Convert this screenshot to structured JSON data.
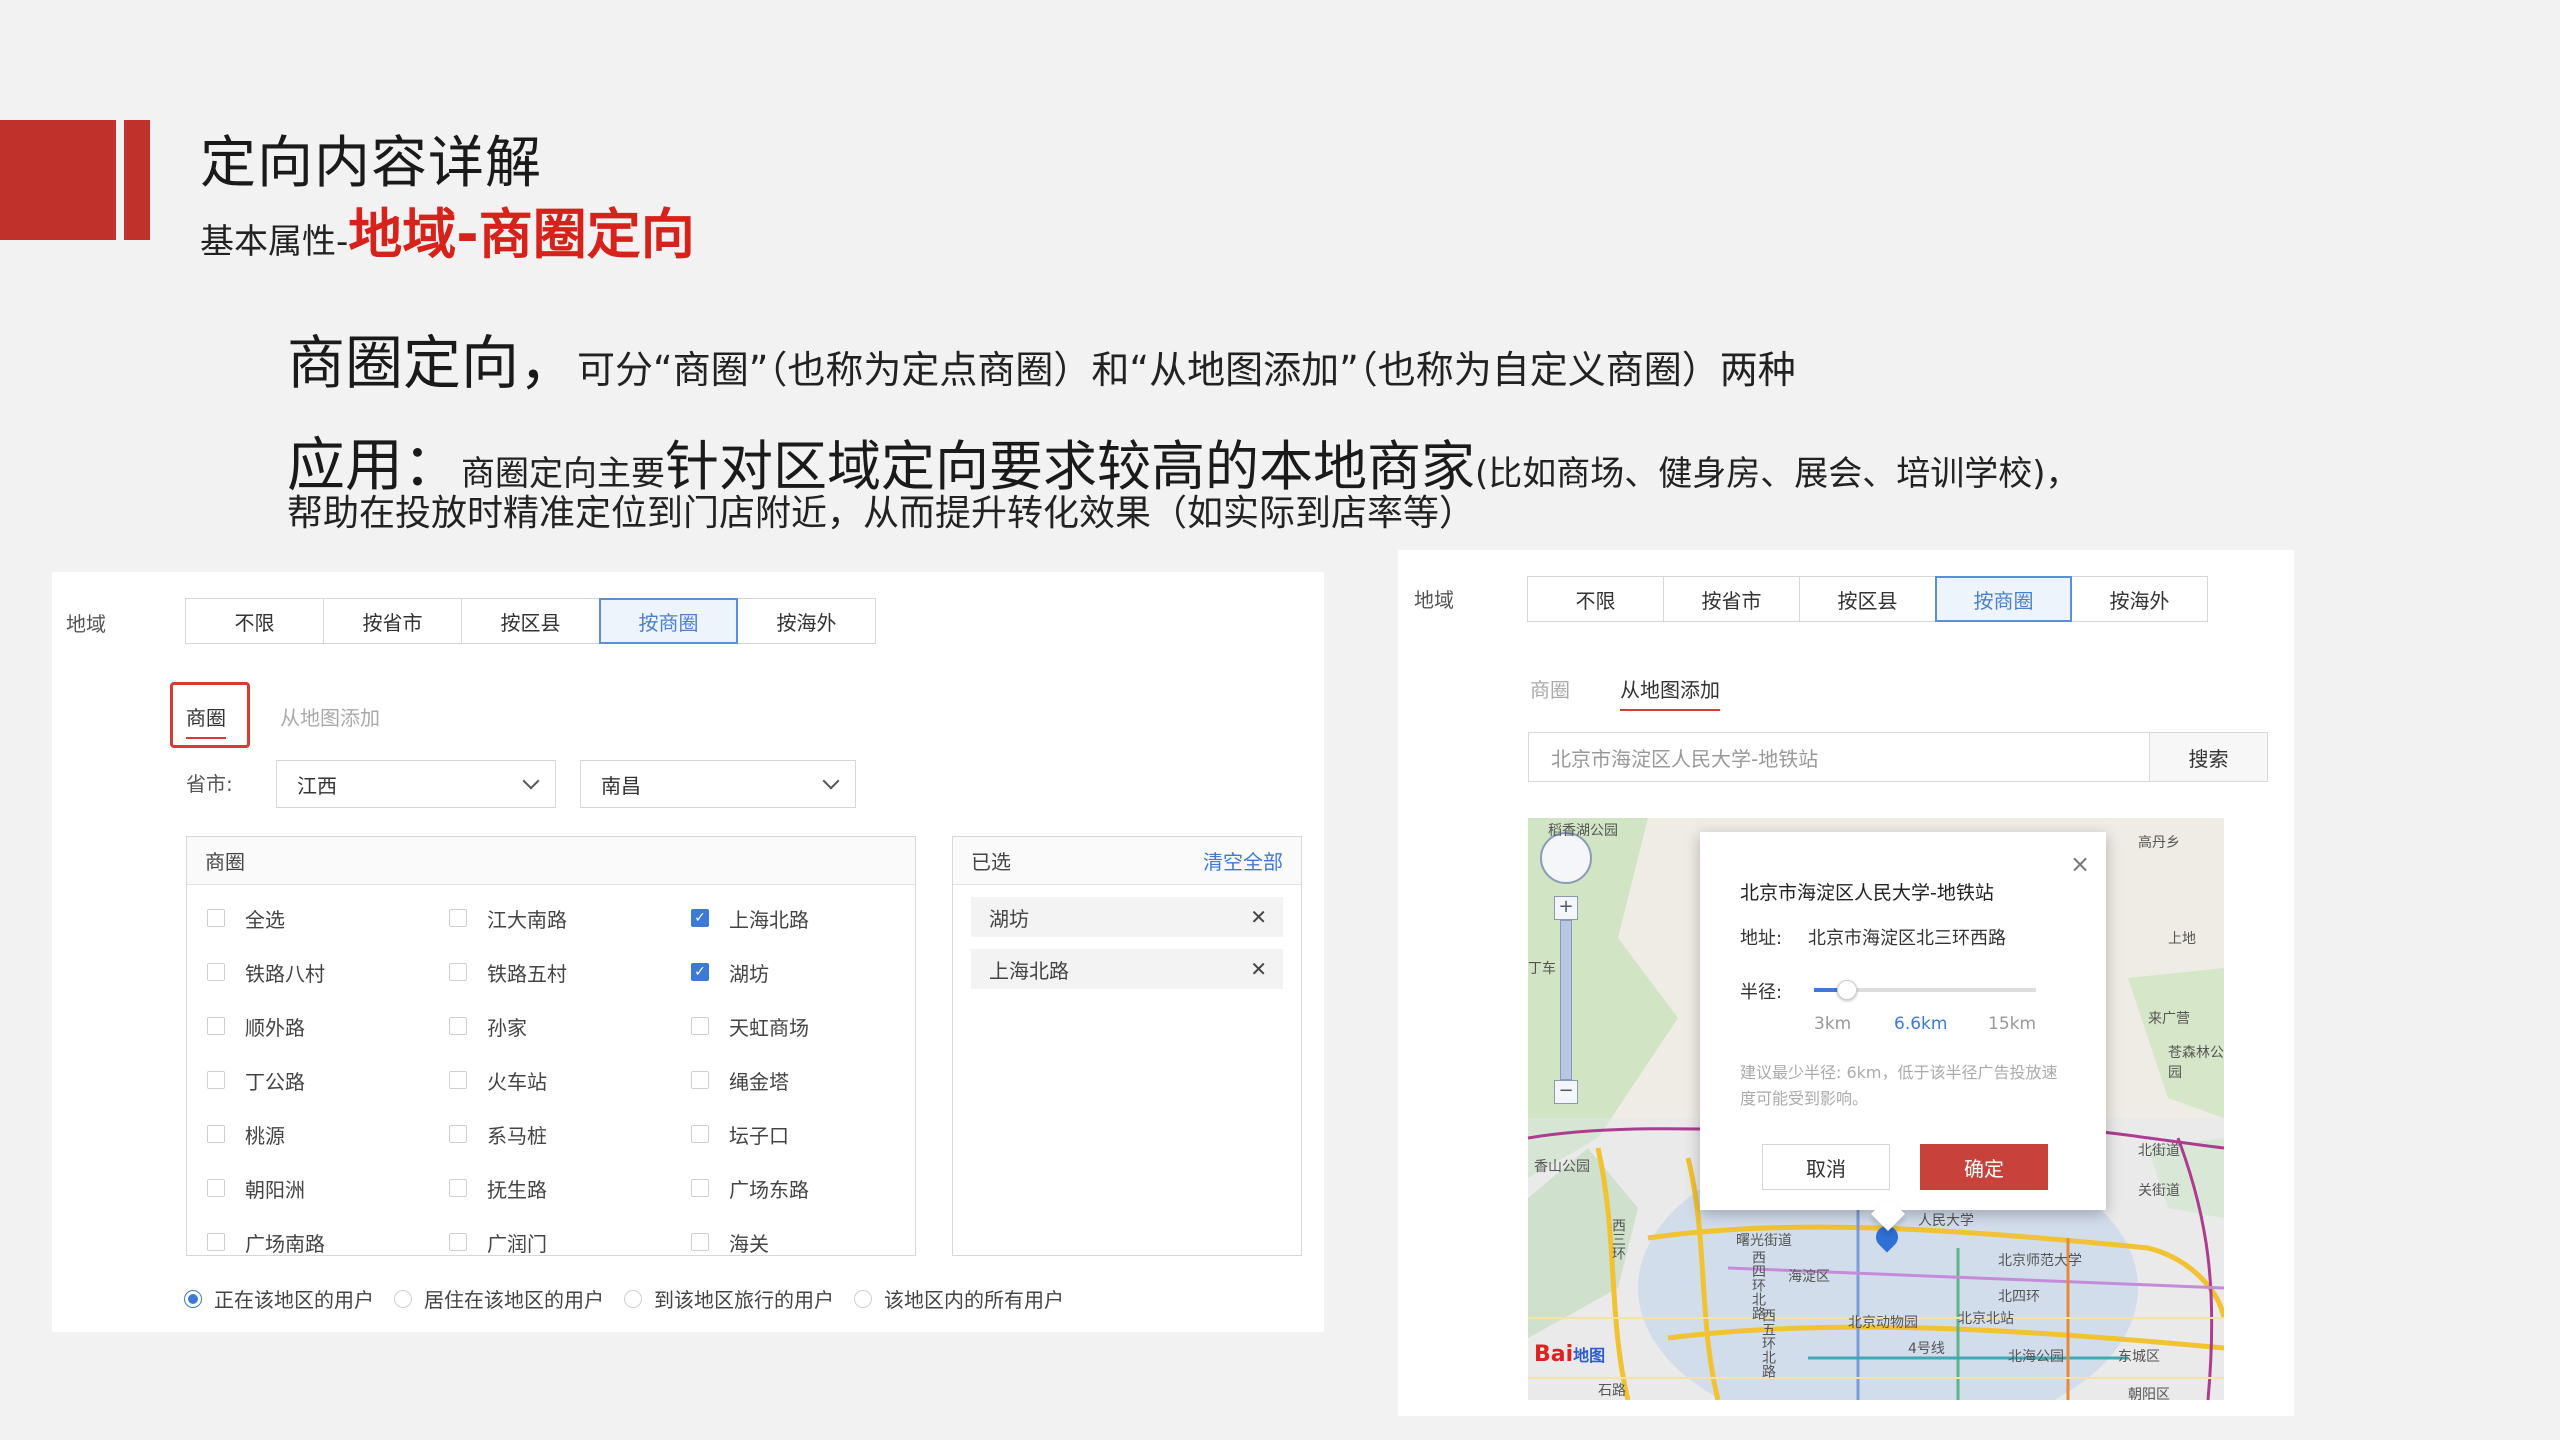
{
  "header": {
    "title": "定向内容详解",
    "subtitle_prefix": "基本属性-",
    "subtitle_highlight": "地域-商圈定向"
  },
  "body": {
    "line1_big": "商圈定向，",
    "line1_rest": "可分“商圈”（也称为定点商圈）和“从地图添加”（也称为自定义商圈）两种",
    "line2_big": "应用：",
    "line2_small": "商圈定向主要",
    "line2_mid": "针对区域定向要求较高的本地商家",
    "line2_tail": "(比如商场、健身房、展会、培训学校)，",
    "line3": "帮助在投放时精准定位到门店附近，从而提升转化效果（如实际到店率等）"
  },
  "left_panel": {
    "region_label": "地域",
    "tabs": [
      {
        "label": "不限",
        "active": false
      },
      {
        "label": "按省市",
        "active": false
      },
      {
        "label": "按区县",
        "active": false
      },
      {
        "label": "按商圈",
        "active": true
      },
      {
        "label": "按海外",
        "active": false
      }
    ],
    "subtab_active": "商圈",
    "subtab_other": "从地图添加",
    "province_label": "省市:",
    "province_value": "江西",
    "city_value": "南昌",
    "list_header": "商圈",
    "items": [
      {
        "label": "全选",
        "checked": false
      },
      {
        "label": "江大南路",
        "checked": false
      },
      {
        "label": "上海北路",
        "checked": true
      },
      {
        "label": "铁路八村",
        "checked": false
      },
      {
        "label": "铁路五村",
        "checked": false
      },
      {
        "label": "湖坊",
        "checked": true
      },
      {
        "label": "顺外路",
        "checked": false
      },
      {
        "label": "孙家",
        "checked": false
      },
      {
        "label": "天虹商场",
        "checked": false
      },
      {
        "label": "丁公路",
        "checked": false
      },
      {
        "label": "火车站",
        "checked": false
      },
      {
        "label": "绳金塔",
        "checked": false
      },
      {
        "label": "桃源",
        "checked": false
      },
      {
        "label": "系马桩",
        "checked": false
      },
      {
        "label": "坛子口",
        "checked": false
      },
      {
        "label": "朝阳洲",
        "checked": false
      },
      {
        "label": "抚生路",
        "checked": false
      },
      {
        "label": "广场东路",
        "checked": false
      },
      {
        "label": "广场南路",
        "checked": false
      },
      {
        "label": "广润门",
        "checked": false
      },
      {
        "label": "海关",
        "checked": false
      }
    ],
    "selected_header": "已选",
    "clear_all": "清空全部",
    "selected": [
      "湖坊",
      "上海北路"
    ],
    "remove_glyph": "✕",
    "radios": [
      {
        "label": "正在该地区的用户",
        "on": true
      },
      {
        "label": "居住在该地区的用户",
        "on": false
      },
      {
        "label": "到该地区旅行的用户",
        "on": false
      },
      {
        "label": "该地区内的所有用户",
        "on": false
      }
    ]
  },
  "right_panel": {
    "region_label": "地域",
    "tabs": [
      {
        "label": "不限",
        "active": false
      },
      {
        "label": "按省市",
        "active": false
      },
      {
        "label": "按区县",
        "active": false
      },
      {
        "label": "按商圈",
        "active": true
      },
      {
        "label": "按海外",
        "active": false
      }
    ],
    "subtab_other": "商圈",
    "subtab_active": "从地图添加",
    "search_value": "北京市海淀区人民大学-地铁站",
    "search_button": "搜索",
    "popup": {
      "title": "北京市海淀区人民大学-地铁站",
      "close": "×",
      "address_label": "地址:",
      "address_value": "北京市海淀区北三环西路",
      "radius_label": "半径:",
      "radius_marks": [
        "3km",
        "6.6km",
        "15km"
      ],
      "radius_value_km": 6.6,
      "hint": "建议最少半径: 6km，低于该半径广告投放速度可能受到影响。",
      "cancel": "取消",
      "confirm": "确定"
    },
    "map_labels": [
      "稻香湖公园",
      "高丹乡",
      "丁车",
      "上地",
      "来广营",
      "苍森林公园",
      "香山公园",
      "北街道",
      "关街道",
      "曙光街道",
      "人民大学",
      "北京师范大学",
      "北四环",
      "西三环",
      "西四环北路",
      "西五环北路",
      "海淀区",
      "北京动物园",
      "4号线",
      "北京北站",
      "北海公园",
      "东城区",
      "朝阳区",
      "石路"
    ],
    "map_brand": "Bai地图",
    "map_brand_red": "Bai",
    "map_brand_blue": "地图",
    "colors": {
      "accent": "#c0312b",
      "blue": "#3d7ad6",
      "confirm": "#c9413b"
    }
  }
}
